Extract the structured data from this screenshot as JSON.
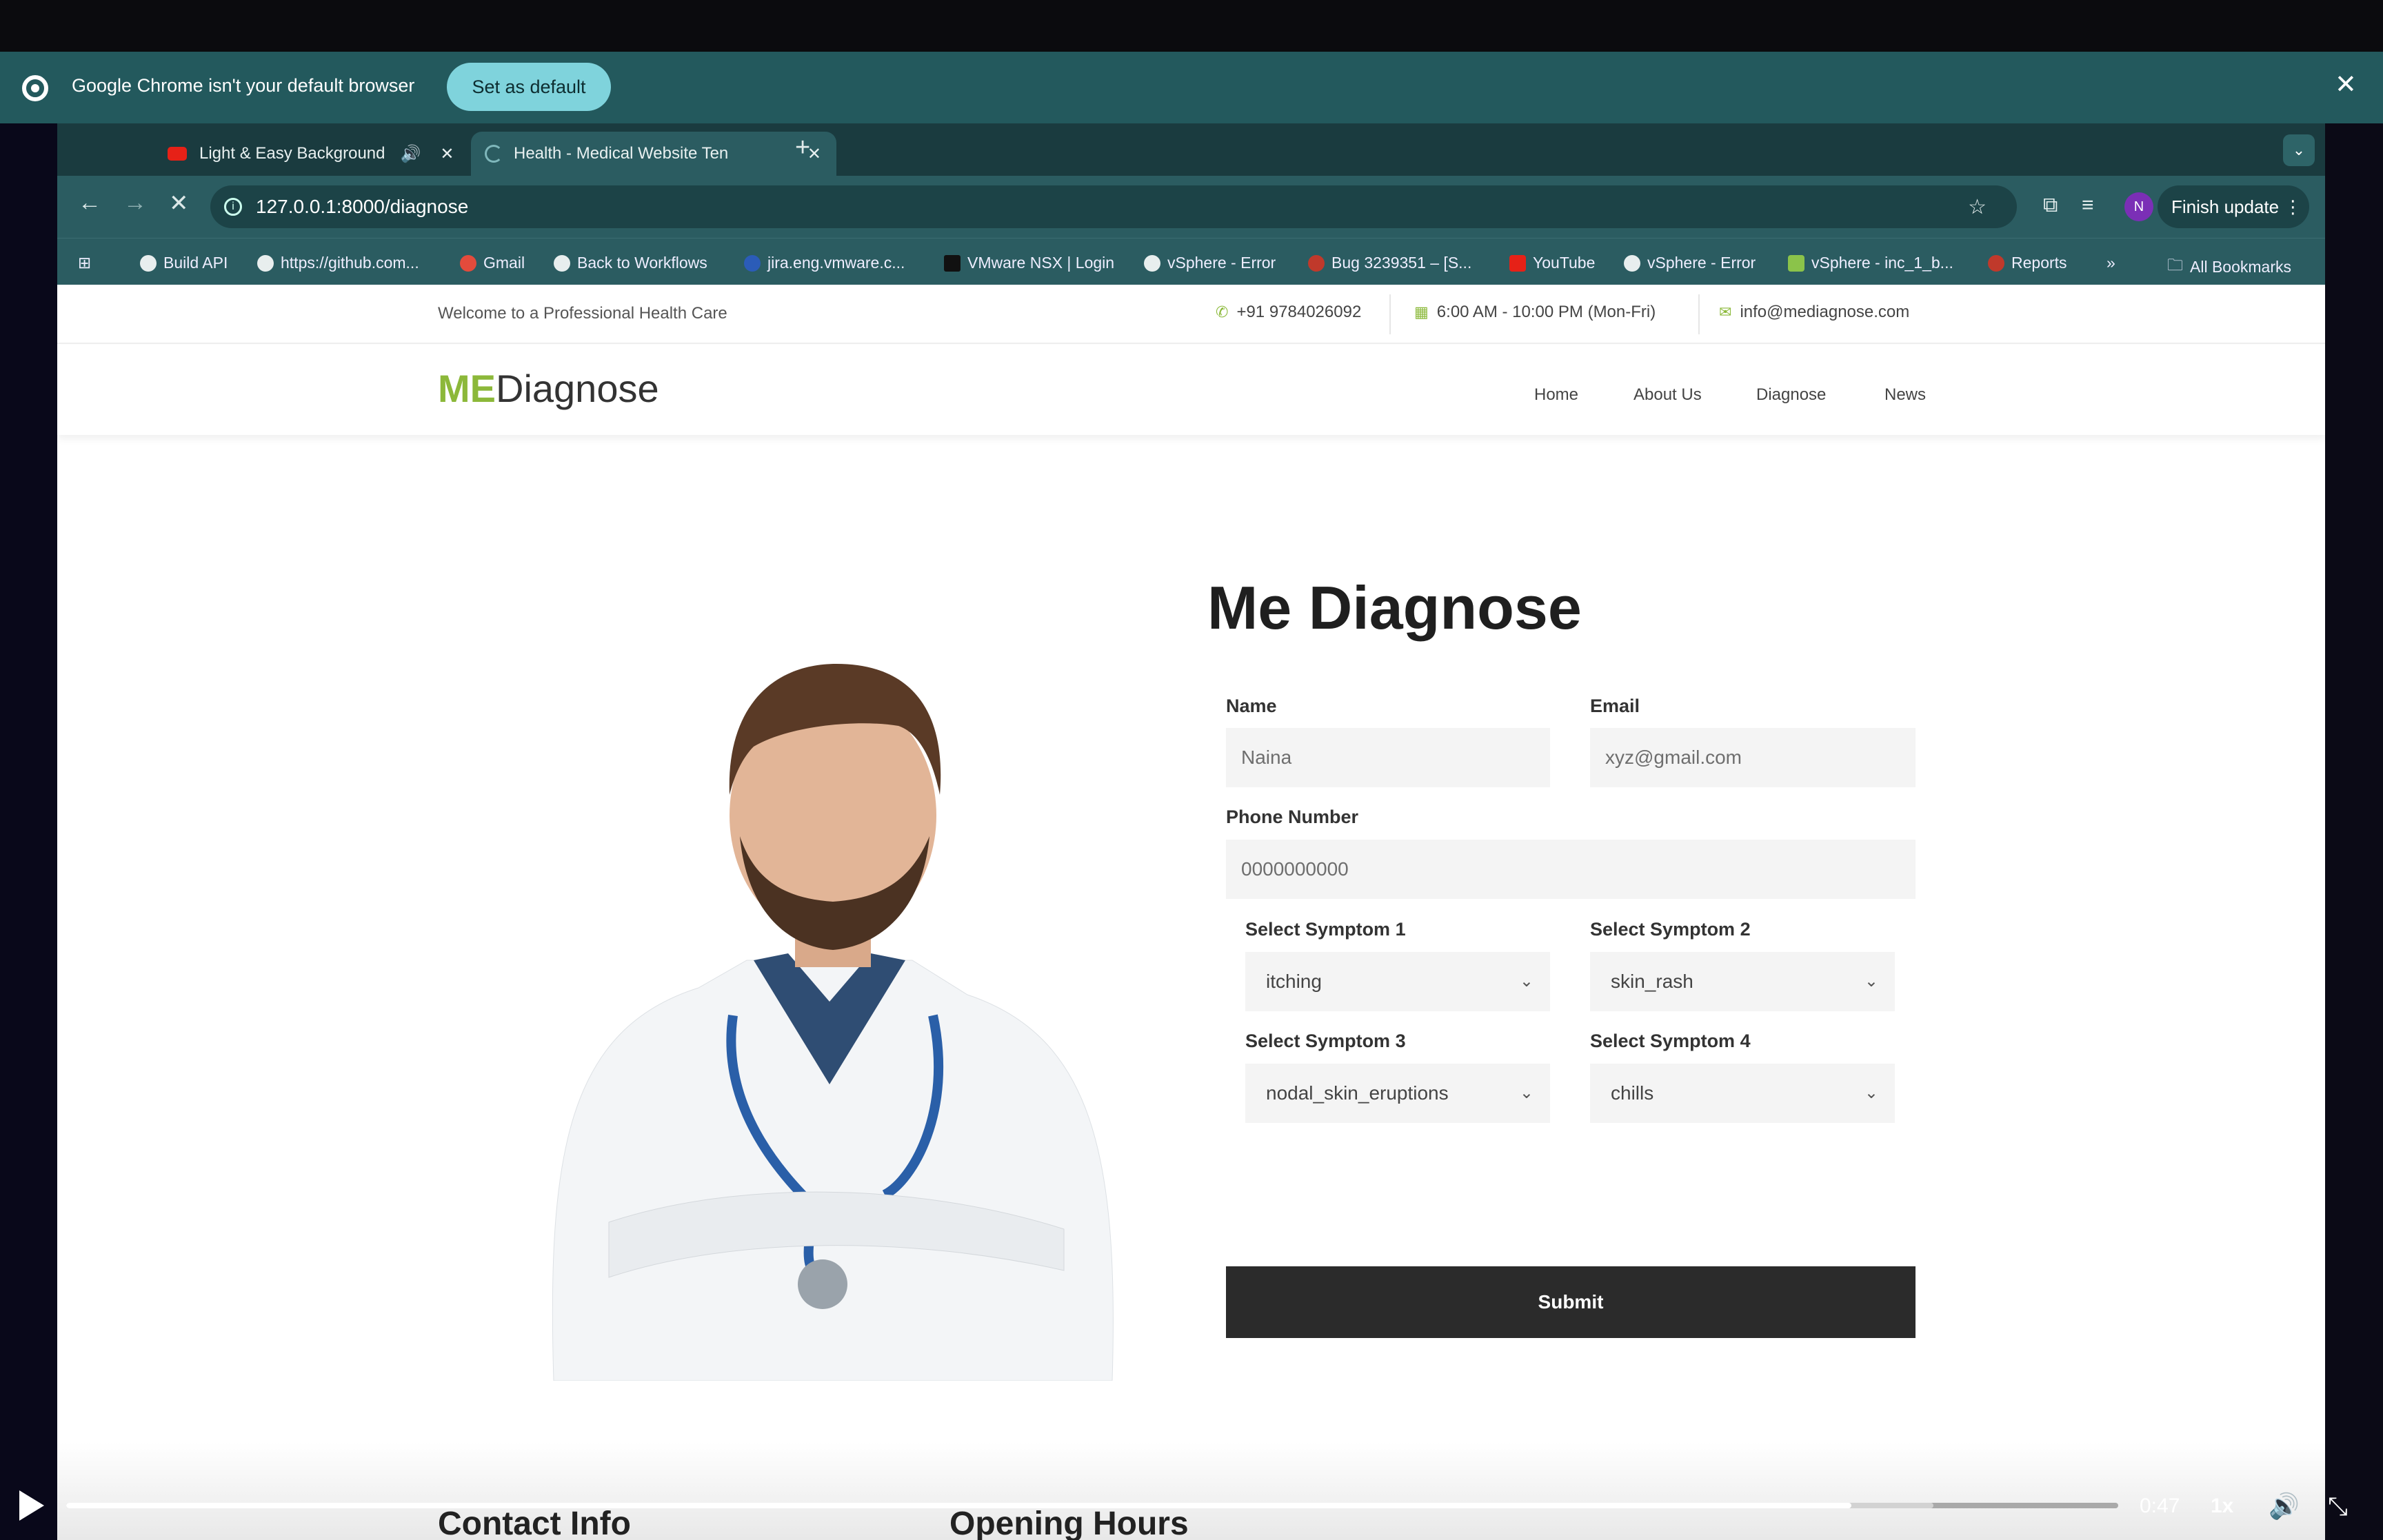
{
  "infobar": {
    "message": "Google Chrome isn't your default browser",
    "button": "Set as default",
    "close": "✕"
  },
  "tabs": [
    {
      "title": "Light & Easy Background",
      "close": "✕"
    },
    {
      "title": "Health - Medical Website Ten",
      "close": "✕"
    }
  ],
  "new_tab": "+",
  "address": {
    "url": "127.0.0.1:8000/diagnose"
  },
  "toolbar": {
    "avatar": "N",
    "finish_update": "Finish update ⋮"
  },
  "bookmarks": [
    "Build API",
    "https://github.com...",
    "Gmail",
    "Back to Workflows",
    "jira.eng.vmware.c...",
    "VMware NSX | Login",
    "vSphere - Error",
    "Bug 3239351 – [S...",
    "YouTube",
    "vSphere - Error",
    "vSphere - inc_1_b...",
    "Reports",
    "»",
    "All Bookmarks"
  ],
  "site": {
    "welcome": "Welcome to a Professional Health Care",
    "phone": "+91 9784026092",
    "hours": "6:00 AM - 10:00 PM (Mon-Fri)",
    "email": "info@mediagnose.com",
    "logo_me": "ME",
    "logo_rest": "Diagnose",
    "menu": [
      "Home",
      "About Us",
      "Diagnose",
      "News"
    ]
  },
  "form": {
    "title": "Me Diagnose",
    "name_label": "Name",
    "name_value": "Naina",
    "email_label": "Email",
    "email_value": "xyz@gmail.com",
    "phone_label": "Phone Number",
    "phone_value": "0000000000",
    "s1_label": "Select Symptom 1",
    "s1_value": "itching",
    "s2_label": "Select Symptom 2",
    "s2_value": "skin_rash",
    "s3_label": "Select Symptom 3",
    "s3_value": "nodal_skin_eruptions",
    "s4_label": "Select Symptom 4",
    "s4_value": "chills",
    "submit": "Submit"
  },
  "footer": {
    "contact": "Contact Info",
    "opening": "Opening Hours"
  },
  "video": {
    "time": "0:47",
    "speed": "1x",
    "played_fraction": 0.87,
    "buffered_fraction": 0.91
  }
}
